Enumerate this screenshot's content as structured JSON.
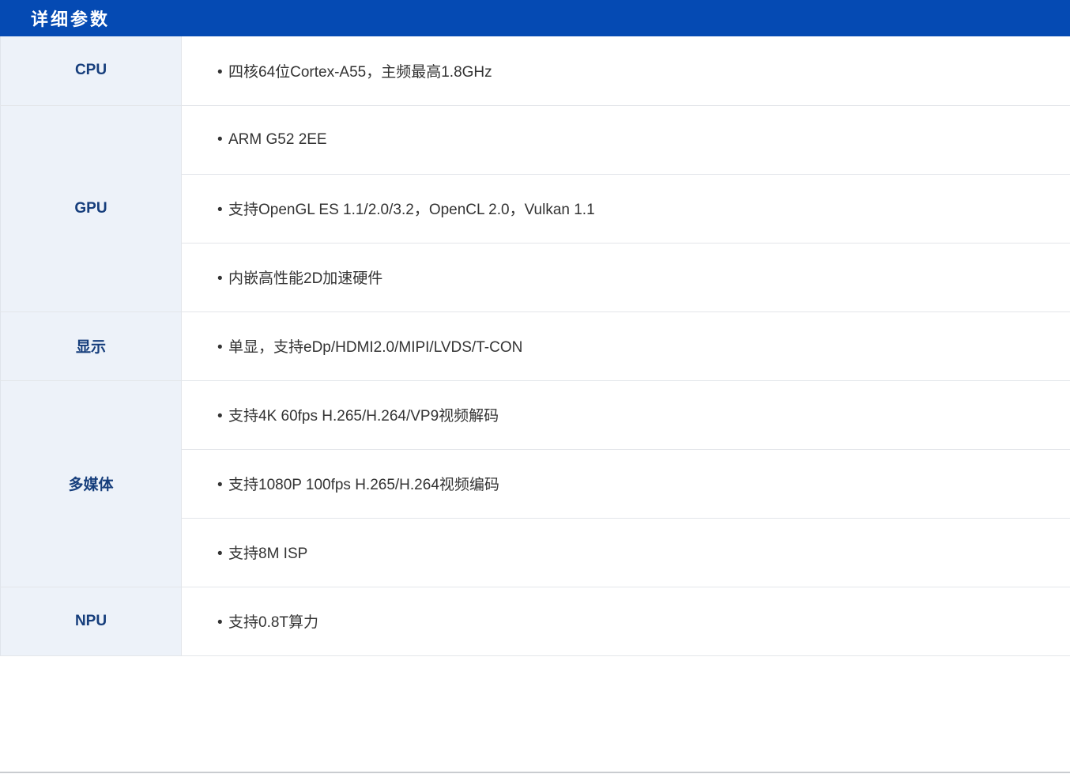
{
  "header": {
    "title": "详细参数"
  },
  "bullet": "•",
  "specs": {
    "cpu": {
      "label": "CPU",
      "items": [
        "四核64位Cortex-A55，主频最高1.8GHz"
      ]
    },
    "gpu": {
      "label": "GPU",
      "items": [
        "ARM G52 2EE",
        "支持OpenGL ES 1.1/2.0/3.2，OpenCL 2.0，Vulkan 1.1",
        "内嵌高性能2D加速硬件"
      ]
    },
    "display": {
      "label": "显示",
      "items": [
        "单显，支持eDp/HDMI2.0/MIPI/LVDS/T-CON"
      ]
    },
    "multimedia": {
      "label": "多媒体",
      "items": [
        "支持4K 60fps H.265/H.264/VP9视频解码",
        "支持1080P 100fps H.265/H.264视频编码",
        "支持8M ISP"
      ]
    },
    "npu": {
      "label": "NPU",
      "items": [
        "支持0.8T算力"
      ]
    }
  },
  "colors": {
    "header_bg": "#054ab3",
    "label_bg": "#edf2f9",
    "label_text": "#163e7c",
    "value_text": "#333333"
  }
}
